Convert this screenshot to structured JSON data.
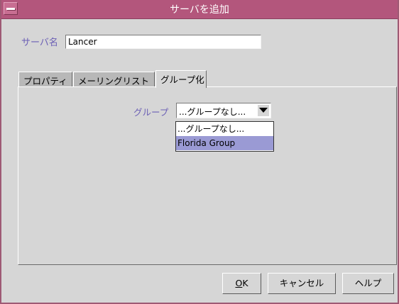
{
  "window": {
    "title": "サーバを追加"
  },
  "server": {
    "label": "サーバ名",
    "value": "Lancer"
  },
  "tabs": [
    {
      "label": "プロパティ"
    },
    {
      "label": "メーリングリスト"
    },
    {
      "label": "グループ化"
    }
  ],
  "group": {
    "label": "グループ",
    "selected": "...グループなし...",
    "options": [
      "...グループなし...",
      "Florida Group"
    ],
    "highlighted": "Florida Group"
  },
  "buttons": {
    "ok_mnemonic": "O",
    "ok_rest": "K",
    "cancel": "キャンセル",
    "help": "ヘルプ"
  },
  "colors": {
    "titlebar": "#b3567c",
    "label_text": "#6b5fb5",
    "selection": "#9a9ad4"
  }
}
